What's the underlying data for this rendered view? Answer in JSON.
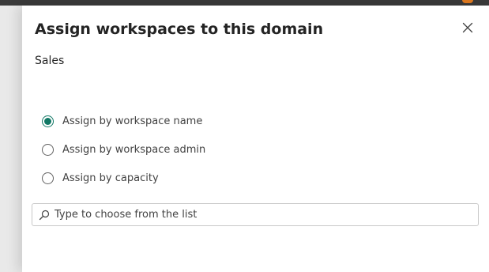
{
  "dialog": {
    "title": "Assign workspaces to this domain",
    "domain_name": "Sales",
    "close_icon": "close-icon"
  },
  "assign_options": [
    {
      "label": "Assign by workspace name",
      "selected": true
    },
    {
      "label": "Assign by workspace admin",
      "selected": false
    },
    {
      "label": "Assign by capacity",
      "selected": false
    }
  ],
  "search": {
    "icon": "search-icon",
    "placeholder": "Type to choose from the list",
    "value": ""
  },
  "colors": {
    "accent": "#117865",
    "text": "#242424"
  }
}
